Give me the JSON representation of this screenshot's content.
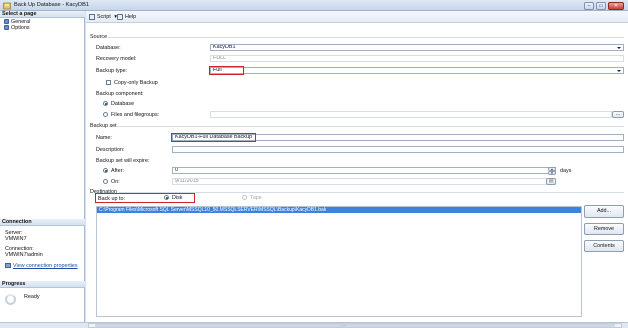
{
  "window": {
    "title": "Back Up Database - KacyDB1",
    "buttons": {
      "minimize": "–",
      "maximize": "▭",
      "close": "✕"
    }
  },
  "left_pane": {
    "select_page_header": "Select a page",
    "pages": [
      {
        "label": "General",
        "icon": "page-icon"
      },
      {
        "label": "Options",
        "icon": "page-icon"
      }
    ],
    "connection_header": "Connection",
    "server_label": "Server:",
    "server_value": "VMWIN7",
    "connection_label": "Connection:",
    "connection_value": "VMWIN7\\admin",
    "view_connection_link": "View connection properties",
    "progress_header": "Progress",
    "progress_status": "Ready"
  },
  "toolbar": {
    "script_label": "Script",
    "script_dropdown_glyph": "▾",
    "help_label": "Help"
  },
  "source": {
    "section_label": "Source",
    "database_label": "Database:",
    "database_value": "KacyDB1",
    "recovery_label": "Recovery model:",
    "recovery_value": "FULL",
    "backup_type_label": "Backup type:",
    "backup_type_value": "Full",
    "copy_only_label": "Copy-only Backup",
    "copy_only_checked": false,
    "component_label": "Backup component:",
    "component_database": "Database",
    "component_files": "Files and filegroups:",
    "component_selected": "Database",
    "files_button": "..."
  },
  "backup_set": {
    "section_label": "Backup set",
    "name_label": "Name:",
    "name_value": "KacyDB1-Full Database Backup",
    "description_label": "Description:",
    "description_value": "",
    "expire_label": "Backup set will expire:",
    "after_label": "After:",
    "after_value": "0",
    "after_unit": "days",
    "on_label": "On:",
    "on_value": "9/11/2015",
    "expire_selected": "After"
  },
  "destination": {
    "section_label": "Destination",
    "backup_to_label": "Back up to:",
    "disk_label": "Disk",
    "tape_label": "Tape",
    "selected": "Disk",
    "paths": [
      "C:\\Program Files\\Microsoft SQL Server\\MSSQL10_50.MSSQLSERVER\\MSSQL\\Backup\\KacyDB1.bak"
    ],
    "add_button": "Add...",
    "remove_button": "Remove",
    "contents_button": "Contents"
  },
  "spin": {
    "up": "▲",
    "down": "▼",
    "calendar": "▦"
  },
  "scroll": {
    "center_glyph": "···"
  },
  "colors": {
    "highlight_red": "#d2232a",
    "selection_blue": "#3d83dd",
    "link_blue": "#1f4fa3"
  }
}
